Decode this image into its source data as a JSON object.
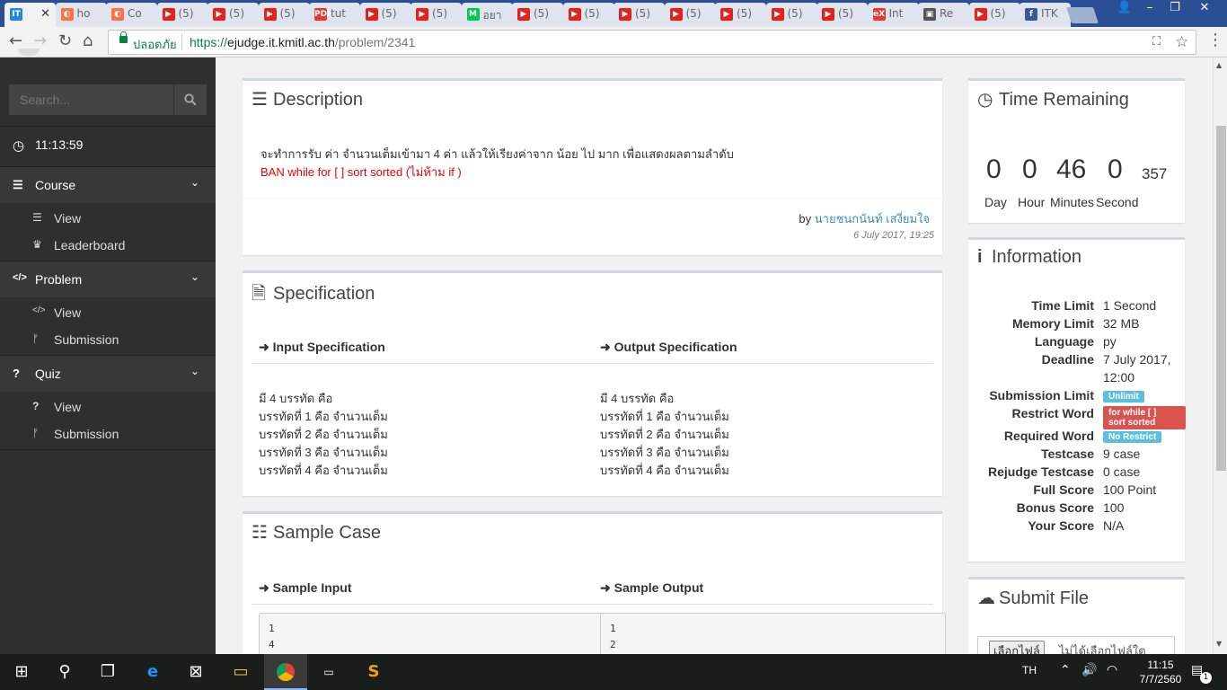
{
  "browser": {
    "tabs": [
      {
        "title": "",
        "favicon": "IT",
        "color": "#1e88e5",
        "active": true
      },
      {
        "title": "ho",
        "favicon": "◐",
        "color": "#ff7043"
      },
      {
        "title": "Co",
        "favicon": "◐",
        "color": "#ff7043"
      },
      {
        "title": "(5)",
        "favicon": "▶",
        "color": "#e62117"
      },
      {
        "title": "(5)",
        "favicon": "▶",
        "color": "#e62117"
      },
      {
        "title": "(5)",
        "favicon": "▶",
        "color": "#e62117"
      },
      {
        "title": "tut",
        "favicon": "PDF",
        "color": "#e53935"
      },
      {
        "title": "(5)",
        "favicon": "▶",
        "color": "#e62117"
      },
      {
        "title": "(5)",
        "favicon": "▶",
        "color": "#e62117"
      },
      {
        "title": "อยา",
        "favicon": "M",
        "color": "#00c853"
      },
      {
        "title": "(5)",
        "favicon": "▶",
        "color": "#e62117"
      },
      {
        "title": "(5)",
        "favicon": "▶",
        "color": "#e62117"
      },
      {
        "title": "(5)",
        "favicon": "▶",
        "color": "#e62117"
      },
      {
        "title": "(5)",
        "favicon": "▶",
        "color": "#e62117"
      },
      {
        "title": "(5)",
        "favicon": "▶",
        "color": "#e62117"
      },
      {
        "title": "(5)",
        "favicon": "▶",
        "color": "#e62117"
      },
      {
        "title": "(5)",
        "favicon": "▶",
        "color": "#e62117"
      },
      {
        "title": "Int",
        "favicon": "eX",
        "color": "#e53935"
      },
      {
        "title": "Re",
        "favicon": "▣",
        "color": "#555555"
      },
      {
        "title": "(5)",
        "favicon": "▶",
        "color": "#e62117"
      },
      {
        "title": "ITK",
        "favicon": "f",
        "color": "#3b5998"
      }
    ],
    "security_label": "ปลอดภัย",
    "url": "https://ejudge.it.kmitl.ac.th/problem/2341",
    "url_scheme": "https://",
    "url_host": "ejudge.it.kmitl.ac.th",
    "url_path": "/problem/2341"
  },
  "sidebar": {
    "search_placeholder": "Search...",
    "clock": "11:13:59",
    "sections": [
      {
        "title": "Course",
        "icon": "≡",
        "items": [
          {
            "label": "View",
            "icon": "≡"
          },
          {
            "label": "Leaderboard",
            "icon": "🏆"
          }
        ]
      },
      {
        "title": "Problem",
        "icon": "</>",
        "items": [
          {
            "label": "View",
            "icon": "</>"
          },
          {
            "label": "Submission",
            "icon": "ᚠ"
          }
        ]
      },
      {
        "title": "Quiz",
        "icon": "?",
        "items": [
          {
            "label": "View",
            "icon": "?"
          },
          {
            "label": "Submission",
            "icon": "ᚠ"
          }
        ]
      }
    ]
  },
  "description": {
    "title": "Description",
    "text": "จะทำการรับ ค่า จำนวนเต็มเข้ามา 4 ค่า แล้วให้เรียงค่าจาก น้อย ไป มาก เพื่อแสดงผลตามลำดับ",
    "ban_text": "BAN while for [ ] sort sorted (ไม่ห้าม if )",
    "by_label": "by",
    "author": "นายชนกนันท์ เสงี่ยมใจ",
    "date": "6 July 2017, 19:25"
  },
  "specification": {
    "title": "Specification",
    "input_title": "Input Specification",
    "output_title": "Output Specification",
    "input_lines": [
      "มี 4 บรรทัด คือ",
      "บรรทัดที่ 1 คือ จำนวนเต็ม",
      "บรรทัดที่ 2 คือ จำนวนเต็ม",
      "บรรทัดที่ 3 คือ จำนวนเต็ม",
      "บรรทัดที่ 4 คือ จำนวนเต็ม"
    ],
    "output_lines": [
      "มี 4 บรรทัด คือ",
      "บรรทัดที่ 1 คือ จำนวนเต็ม",
      "บรรทัดที่ 2 คือ จำนวนเต็ม",
      "บรรทัดที่ 3 คือ จำนวนเต็ม",
      "บรรทัดที่ 4 คือ จำนวนเต็ม"
    ]
  },
  "sample": {
    "title": "Sample Case",
    "input_title": "Sample Input",
    "output_title": "Sample Output",
    "input_lines": [
      "1",
      "4"
    ],
    "output_lines": [
      "1",
      "2"
    ]
  },
  "time_remaining": {
    "title": "Time Remaining",
    "day": "0",
    "hour": "0",
    "minutes": "46",
    "second": "0",
    "millis": "357",
    "day_label": "Day",
    "hour_label": "Hour",
    "minutes_label": "Minutes",
    "second_label": "Second"
  },
  "information": {
    "title": "Information",
    "rows": [
      {
        "label": "Time Limit",
        "value": "1 Second"
      },
      {
        "label": "Memory Limit",
        "value": "32 MB"
      },
      {
        "label": "Language",
        "value": "py"
      },
      {
        "label": "Deadline",
        "value": "7 July 2017,",
        "value2": "12:00"
      },
      {
        "label": "Submission Limit",
        "badge": "Unlimit",
        "badge_color": "#5bc0de"
      },
      {
        "label": "Restrict Word",
        "badge": "for while [ ]",
        "badge2": "sort sorted",
        "badge_color": "#d9534f"
      },
      {
        "label": "Required Word",
        "badge": "No Restrict",
        "badge_color": "#5bc0de"
      },
      {
        "label": "Testcase",
        "value": "9 case"
      },
      {
        "label": "Rejudge Testcase",
        "value": "0 case"
      },
      {
        "label": "Full Score",
        "value": "100 Point"
      },
      {
        "label": "Bonus Score",
        "value": "100"
      },
      {
        "label": "Your Score",
        "value": "N/A"
      }
    ]
  },
  "submit": {
    "title": "Submit File",
    "choose_label": "เลือกไฟล์",
    "no_file_label": "ไม่ได้เลือกไฟล์ใด"
  },
  "taskbar": {
    "language": "TH",
    "time": "11:15",
    "date": "7/7/2560",
    "notifications": "1"
  },
  "colors": {
    "accent": "#3c8dbc",
    "danger": "#d9534f",
    "info": "#5bc0de",
    "sidebar": "#2f2f2f"
  }
}
